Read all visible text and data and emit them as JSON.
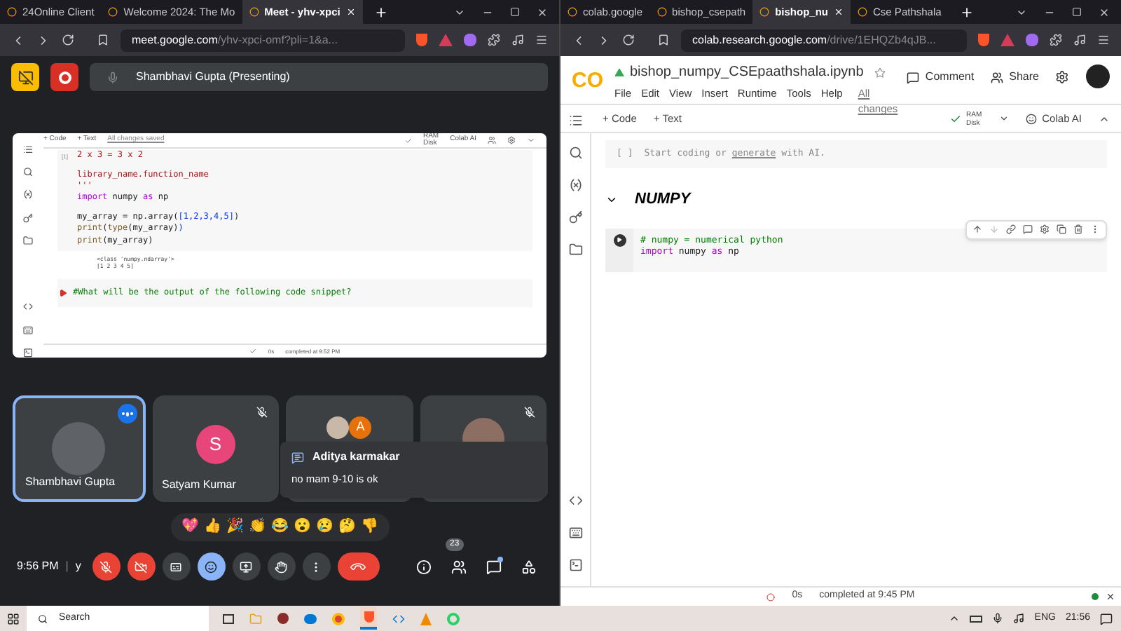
{
  "left_window": {
    "tabs": [
      {
        "label": "24Online Client",
        "selected": false
      },
      {
        "label": "Welcome 2024: The Mo",
        "selected": false
      },
      {
        "label": "Meet - yhv-xpci",
        "selected": true
      }
    ],
    "url_host": "meet.google.com",
    "url_rest": "/yhv-xpci-omf?pli=1&a...",
    "presenter": "Shambhavi Gupta (Presenting)",
    "shared_notebook": {
      "toolbar": [
        "+ Code",
        "+ Text"
      ],
      "saved": "All changes saved",
      "ram": "RAM",
      "disk": "Disk",
      "colab_ai": "Colab AI",
      "cell_number": "[1]",
      "code_blocks": [
        [
          [
            {
              "text": "2 x 3 = 3 x 2",
              "kind": "string"
            }
          ]
        ],
        [
          [
            {
              "text": "library_name.function_name",
              "kind": "string"
            }
          ],
          [
            {
              "text": "'''",
              "kind": "string"
            }
          ],
          [
            {
              "text": "import",
              "kind": "keyword"
            },
            {
              "text": " numpy ",
              "kind": "plain"
            },
            {
              "text": "as",
              "kind": "keyword"
            },
            {
              "text": " np",
              "kind": "plain"
            }
          ]
        ],
        [
          [
            {
              "text": "my_array = np.array(",
              "kind": "plain"
            },
            {
              "text": "[1,2,3,4,5]",
              "kind": "bracket"
            },
            {
              "text": ")",
              "kind": "plain"
            }
          ],
          [
            {
              "text": "print",
              "kind": "builtin"
            },
            {
              "text": "(",
              "kind": "plain"
            },
            {
              "text": "type",
              "kind": "builtin"
            },
            {
              "text": "(my_array)",
              "kind": "plain"
            },
            {
              "text": ")",
              "kind": "bracket"
            }
          ],
          [
            {
              "text": "print",
              "kind": "builtin"
            },
            {
              "text": "(my_array)",
              "kind": "plain"
            }
          ]
        ]
      ],
      "output_lines": [
        "<class 'numpy.ndarray'>",
        "[1 2 3 4 5]"
      ],
      "next_cell": "#What will be the output of the following code snippet?",
      "status_time": "0s",
      "status": "completed at 9:52 PM"
    },
    "participants": [
      {
        "name": "Shambhavi Gupta",
        "kind": "photo",
        "speaking": true,
        "muted": false
      },
      {
        "name": "Satyam Kumar",
        "kind": "initial",
        "initial": "S",
        "color": "#e8467a",
        "speaking": false,
        "muted": true
      },
      {
        "kind": "group",
        "initial": "A",
        "color": "#e8710a",
        "speaking": false,
        "muted": false
      },
      {
        "kind": "photo",
        "speaking": false,
        "muted": true
      }
    ],
    "chat_popup": {
      "sender": "Aditya karmakar",
      "message": "no mam 9-10 is ok"
    },
    "reactions": [
      "💖",
      "👍",
      "🎉",
      "👏",
      "😂",
      "😮",
      "😢",
      "🤔",
      "👎"
    ],
    "clock": "9:56 PM",
    "separator": "|",
    "meeting_code": "y",
    "controls": [
      {
        "kind": "mic",
        "on": false
      },
      {
        "kind": "camera",
        "on": false
      },
      {
        "kind": "captions",
        "on": false
      },
      {
        "kind": "reactions",
        "on": true
      },
      {
        "kind": "present"
      },
      {
        "kind": "hand"
      },
      {
        "kind": "more"
      },
      {
        "kind": "end"
      }
    ],
    "side_controls": [
      {
        "kind": "info"
      },
      {
        "kind": "people",
        "badge": "23"
      },
      {
        "kind": "chat",
        "unread": true
      },
      {
        "kind": "activities"
      }
    ]
  },
  "right_window": {
    "tabs": [
      {
        "label": "colab.google",
        "selected": false
      },
      {
        "label": "bishop_csepath",
        "selected": false
      },
      {
        "label": "bishop_nu",
        "selected": true
      },
      {
        "label": "Cse Pathshala",
        "selected": false
      }
    ],
    "url_host": "colab.research.google.com",
    "url_rest": "/drive/1EHQZb4qJB...",
    "logo": "CO",
    "title": "bishop_numpy_CSEpaathshala.ipynb",
    "menu": [
      "File",
      "Edit",
      "View",
      "Insert",
      "Runtime",
      "Tools",
      "Help"
    ],
    "saved": "All changes",
    "comment": "Comment",
    "share": "Share",
    "toolbar": [
      "+ Code",
      "+ Text"
    ],
    "ram": "RAM",
    "disk": "Disk",
    "colab_ai": "Colab AI",
    "empty_cell": {
      "brackets": "[ ]",
      "before": "Start coding or ",
      "link": "generate",
      "after": " with AI."
    },
    "heading": "NUMPY",
    "code_cell": [
      [
        {
          "text": "# numpy = numerical python",
          "kind": "comment"
        }
      ],
      [
        {
          "text": "import",
          "kind": "keyword"
        },
        {
          "text": " numpy ",
          "kind": "plain"
        },
        {
          "text": "as",
          "kind": "keyword"
        },
        {
          "text": " np",
          "kind": "plain"
        }
      ]
    ],
    "status_time": "0s",
    "status": "completed at 9:45 PM"
  },
  "taskbar": {
    "search": "Search",
    "language": "ENG",
    "time": "21:56"
  }
}
